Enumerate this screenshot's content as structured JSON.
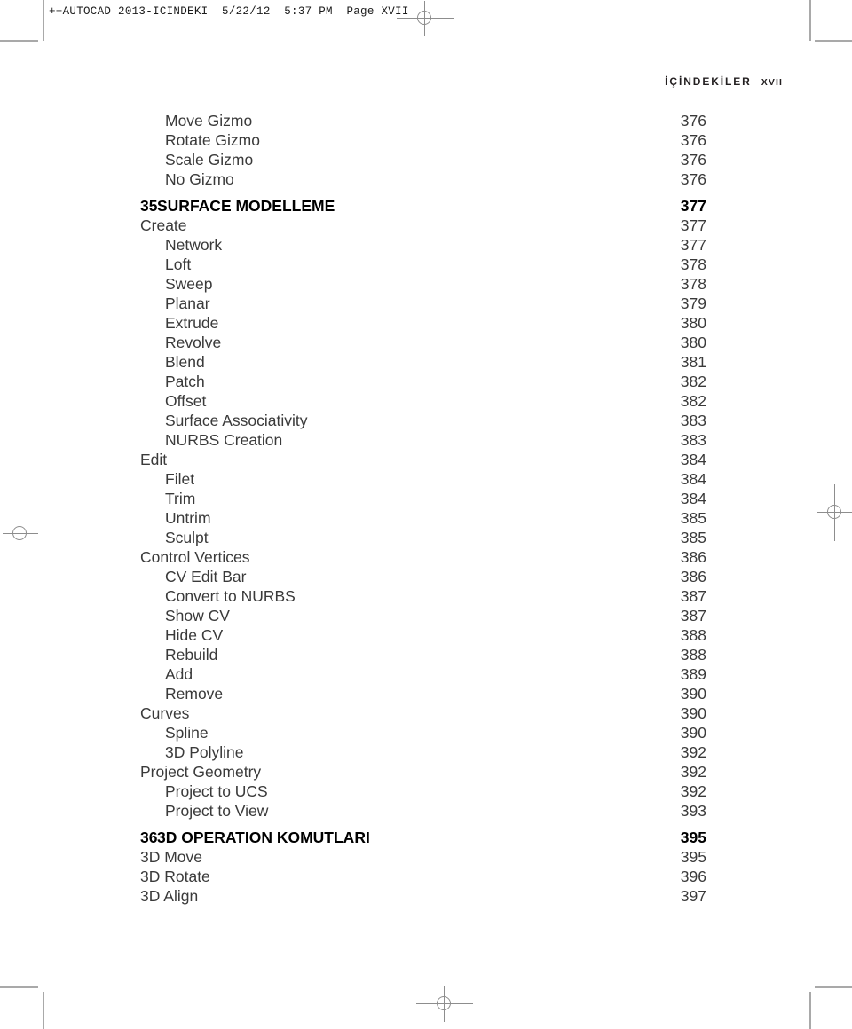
{
  "printer_slug": "++AUTOCAD 2013-ICINDEKI  5/22/12  5:37 PM  Page XVII",
  "running_head": {
    "title": "İÇİNDEKİLER",
    "folio": "XVII"
  },
  "toc": {
    "rows": [
      {
        "level": 1,
        "kind": "entry",
        "label": "Move Gizmo",
        "page": "376"
      },
      {
        "level": 1,
        "kind": "entry",
        "label": "Rotate Gizmo",
        "page": "376"
      },
      {
        "level": 1,
        "kind": "entry",
        "label": "Scale Gizmo",
        "page": "376"
      },
      {
        "level": 1,
        "kind": "entry",
        "label": "No Gizmo",
        "page": "376"
      },
      {
        "level": 0,
        "kind": "chapter",
        "number": "35",
        "label": "SURFACE MODELLEME",
        "page": "377"
      },
      {
        "level": 0,
        "kind": "entry",
        "label": "Create",
        "page": "377"
      },
      {
        "level": 1,
        "kind": "entry",
        "label": "Network",
        "page": "377"
      },
      {
        "level": 1,
        "kind": "entry",
        "label": "Loft",
        "page": "378"
      },
      {
        "level": 1,
        "kind": "entry",
        "label": "Sweep",
        "page": "378"
      },
      {
        "level": 1,
        "kind": "entry",
        "label": "Planar",
        "page": "379"
      },
      {
        "level": 1,
        "kind": "entry",
        "label": "Extrude",
        "page": "380"
      },
      {
        "level": 1,
        "kind": "entry",
        "label": "Revolve",
        "page": "380"
      },
      {
        "level": 1,
        "kind": "entry",
        "label": "Blend",
        "page": "381"
      },
      {
        "level": 1,
        "kind": "entry",
        "label": "Patch",
        "page": "382"
      },
      {
        "level": 1,
        "kind": "entry",
        "label": "Offset",
        "page": "382"
      },
      {
        "level": 1,
        "kind": "entry",
        "label": "Surface Associativity",
        "page": "383"
      },
      {
        "level": 1,
        "kind": "entry",
        "label": "NURBS Creation",
        "page": "383"
      },
      {
        "level": 0,
        "kind": "entry",
        "label": "Edit",
        "page": "384"
      },
      {
        "level": 1,
        "kind": "entry",
        "label": "Filet",
        "page": "384"
      },
      {
        "level": 1,
        "kind": "entry",
        "label": "Trim",
        "page": "384"
      },
      {
        "level": 1,
        "kind": "entry",
        "label": "Untrim",
        "page": "385"
      },
      {
        "level": 1,
        "kind": "entry",
        "label": "Sculpt",
        "page": "385"
      },
      {
        "level": 0,
        "kind": "entry",
        "label": "Control Vertices",
        "page": "386"
      },
      {
        "level": 1,
        "kind": "entry",
        "label": "CV Edit Bar",
        "page": "386"
      },
      {
        "level": 1,
        "kind": "entry",
        "label": "Convert to NURBS",
        "page": "387"
      },
      {
        "level": 1,
        "kind": "entry",
        "label": "Show CV",
        "page": "387"
      },
      {
        "level": 1,
        "kind": "entry",
        "label": "Hide CV",
        "page": "388"
      },
      {
        "level": 1,
        "kind": "entry",
        "label": "Rebuild",
        "page": "388"
      },
      {
        "level": 1,
        "kind": "entry",
        "label": "Add",
        "page": "389"
      },
      {
        "level": 1,
        "kind": "entry",
        "label": "Remove",
        "page": "390"
      },
      {
        "level": 0,
        "kind": "entry",
        "label": "Curves",
        "page": "390"
      },
      {
        "level": 1,
        "kind": "entry",
        "label": "Spline",
        "page": "390"
      },
      {
        "level": 1,
        "kind": "entry",
        "label": "3D Polyline",
        "page": "392"
      },
      {
        "level": 0,
        "kind": "entry",
        "label": "Project Geometry",
        "page": "392"
      },
      {
        "level": 1,
        "kind": "entry",
        "label": "Project to UCS",
        "page": "392"
      },
      {
        "level": 1,
        "kind": "entry",
        "label": "Project to View",
        "page": "393"
      },
      {
        "level": 0,
        "kind": "chapter",
        "number": "36",
        "label": "3D OPERATION KOMUTLARI",
        "page": "395"
      },
      {
        "level": 0,
        "kind": "entry",
        "label": "3D Move",
        "page": "395"
      },
      {
        "level": 0,
        "kind": "entry",
        "label": "3D Rotate",
        "page": "396"
      },
      {
        "level": 0,
        "kind": "entry",
        "label": "3D Align",
        "page": "397"
      }
    ]
  }
}
